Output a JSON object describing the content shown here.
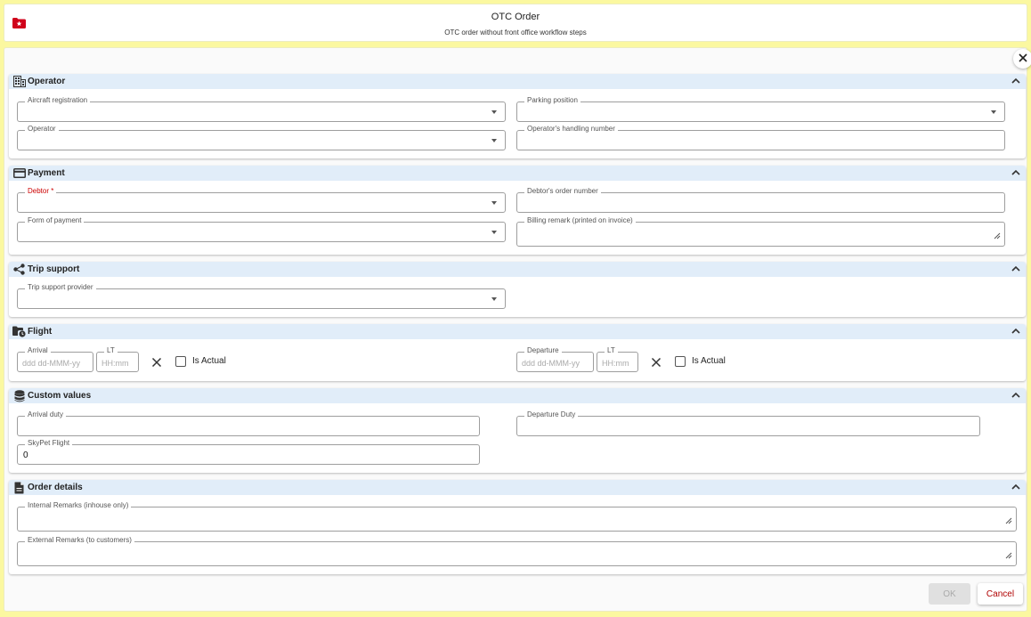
{
  "header": {
    "title": "OTC Order",
    "subtitle": "OTC order without front office workflow steps",
    "icon": "folder-star-icon",
    "icon_color": "#d0021b"
  },
  "sections": {
    "operator": {
      "title": "Operator",
      "aircraft_registration": {
        "label": "Aircraft registration",
        "value": ""
      },
      "parking_position": {
        "label": "Parking position",
        "value": ""
      },
      "operator": {
        "label": "Operator",
        "value": ""
      },
      "handling_number": {
        "label": "Operator's handling number",
        "value": ""
      }
    },
    "payment": {
      "title": "Payment",
      "debtor": {
        "label": "Debtor *",
        "value": ""
      },
      "debtors_order_number": {
        "label": "Debtor's order number",
        "value": ""
      },
      "form_of_payment": {
        "label": "Form of payment",
        "value": ""
      },
      "billing_remark": {
        "label": "Billing remark (printed on invoice)",
        "value": ""
      }
    },
    "trip_support": {
      "title": "Trip support",
      "provider": {
        "label": "Trip support provider",
        "value": ""
      }
    },
    "flight": {
      "title": "Flight",
      "arrival": {
        "label": "Arrival",
        "placeholder": "ddd dd-MMM-yy"
      },
      "arrival_time": {
        "label": "LT",
        "placeholder": "HH:mm"
      },
      "arrival_is_actual": "Is Actual",
      "departure": {
        "label": "Departure",
        "placeholder": "ddd dd-MMM-yy"
      },
      "departure_time": {
        "label": "LT",
        "placeholder": "HH:mm"
      },
      "departure_is_actual": "Is Actual"
    },
    "custom_values": {
      "title": "Custom values",
      "arrival_duty": {
        "label": "Arrival duty",
        "value": ""
      },
      "departure_duty": {
        "label": "Departure Duty",
        "value": ""
      },
      "skypet_flight": {
        "label": "SkyPet Flight",
        "value": "0"
      }
    },
    "order_details": {
      "title": "Order details",
      "internal_remarks": {
        "label": "Internal Remarks (inhouse only)",
        "value": ""
      },
      "external_remarks": {
        "label": "External Remarks (to customers)",
        "value": ""
      }
    }
  },
  "buttons": {
    "ok": "OK",
    "cancel": "Cancel"
  },
  "colors": {
    "page_bg": "#fbf8a0",
    "section_header_bg": "#e1edf9",
    "required": "#cc0000",
    "cancel_text": "#b00000"
  }
}
